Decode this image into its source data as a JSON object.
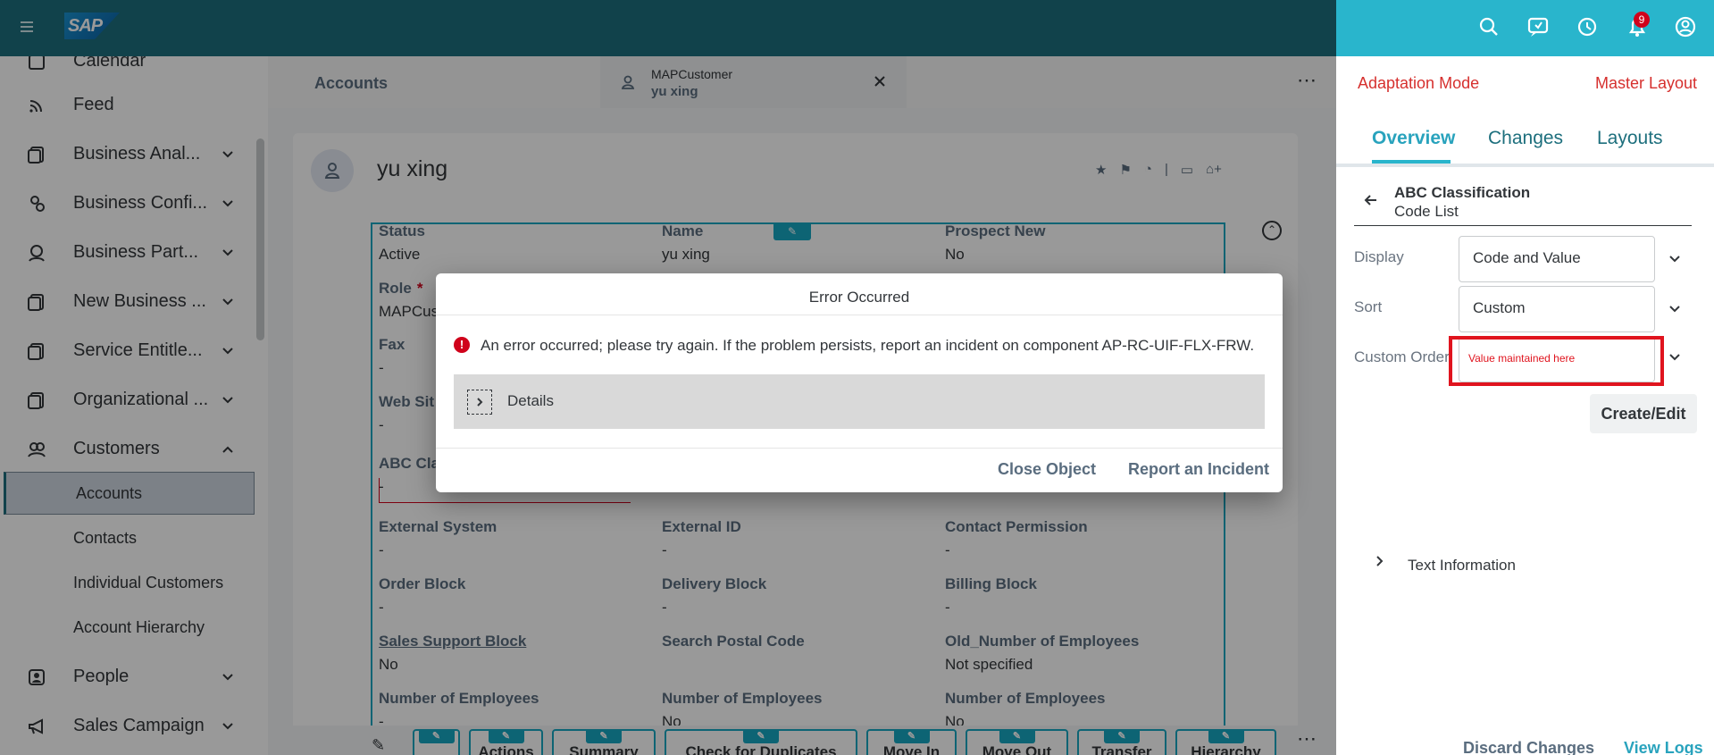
{
  "shell": {
    "logo": "SAP",
    "notification_count": "9"
  },
  "sidebar": {
    "items": [
      {
        "label": "Calendar"
      },
      {
        "label": "Feed"
      },
      {
        "label": "Business Anal..."
      },
      {
        "label": "Business Confi..."
      },
      {
        "label": "Business Part..."
      },
      {
        "label": "New Business ..."
      },
      {
        "label": "Service Entitle..."
      },
      {
        "label": "Organizational ..."
      },
      {
        "label": "Customers"
      },
      {
        "label": "People"
      },
      {
        "label": "Sales Campaign"
      }
    ],
    "sub_items": [
      {
        "label": "Accounts"
      },
      {
        "label": "Contacts"
      },
      {
        "label": "Individual Customers"
      },
      {
        "label": "Account Hierarchy"
      }
    ]
  },
  "main": {
    "breadcrumb": "Accounts",
    "object_tab": {
      "type": "MAPCustomer",
      "name": "yu xing"
    },
    "title": "yu xing",
    "fields": [
      {
        "label": "Status",
        "value": "Active"
      },
      {
        "label": "Name",
        "value": "yu xing"
      },
      {
        "label": "Prospect New",
        "value": "No"
      },
      {
        "label": "Role",
        "value": "MAPCus"
      },
      {
        "label": "Fax",
        "value": "-"
      },
      {
        "label": "Web Sit",
        "value": "-"
      },
      {
        "label": "ABC Cla",
        "value": "-"
      },
      {
        "label": "External System",
        "value": "-"
      },
      {
        "label": "External ID",
        "value": "-"
      },
      {
        "label": "Contact Permission",
        "value": "-"
      },
      {
        "label": "Order Block",
        "value": "-"
      },
      {
        "label": "Delivery Block",
        "value": "-"
      },
      {
        "label": "Billing Block",
        "value": "-"
      },
      {
        "label": "Sales Support Block",
        "value": "No"
      },
      {
        "label": "Search Postal Code",
        "value": ""
      },
      {
        "label": "Old_Number of Employees",
        "value": "Not specified"
      },
      {
        "label": "Number of Employees",
        "value": "-"
      },
      {
        "label": "Number of Employees",
        "value": "No"
      },
      {
        "label": "Number of Employees",
        "value": "No"
      }
    ],
    "footer_buttons": [
      "Actions",
      "Summary",
      "Check for Duplicates",
      "Move In",
      "Move Out",
      "Transfer",
      "Hierarchy"
    ]
  },
  "dialog": {
    "title": "Error Occurred",
    "message": "An error occurred; please try again. If the problem persists, report an incident on component AP-RC-UIF-FLX-FRW.",
    "details_label": "Details",
    "close_label": "Close Object",
    "report_label": "Report an Incident"
  },
  "panel": {
    "mode": "Adaptation Mode",
    "layout": "Master Layout",
    "tabs": [
      "Overview",
      "Changes",
      "Layouts"
    ],
    "section_title": "ABC Classification",
    "section_subtitle": "Code List",
    "display_label": "Display",
    "display_value": "Code and Value",
    "sort_label": "Sort",
    "sort_value": "Custom",
    "custom_order_label": "Custom Order",
    "custom_order_note": "Value maintained here",
    "create_edit_label": "Create/Edit",
    "text_info_label": "Text Information",
    "discard_label": "Discard Changes",
    "view_logs_label": "View Logs"
  },
  "colors": {
    "shell": "#1d6f7d",
    "shell_right": "#29b5cc",
    "error": "#d0021b",
    "accent": "#17a7c1"
  }
}
